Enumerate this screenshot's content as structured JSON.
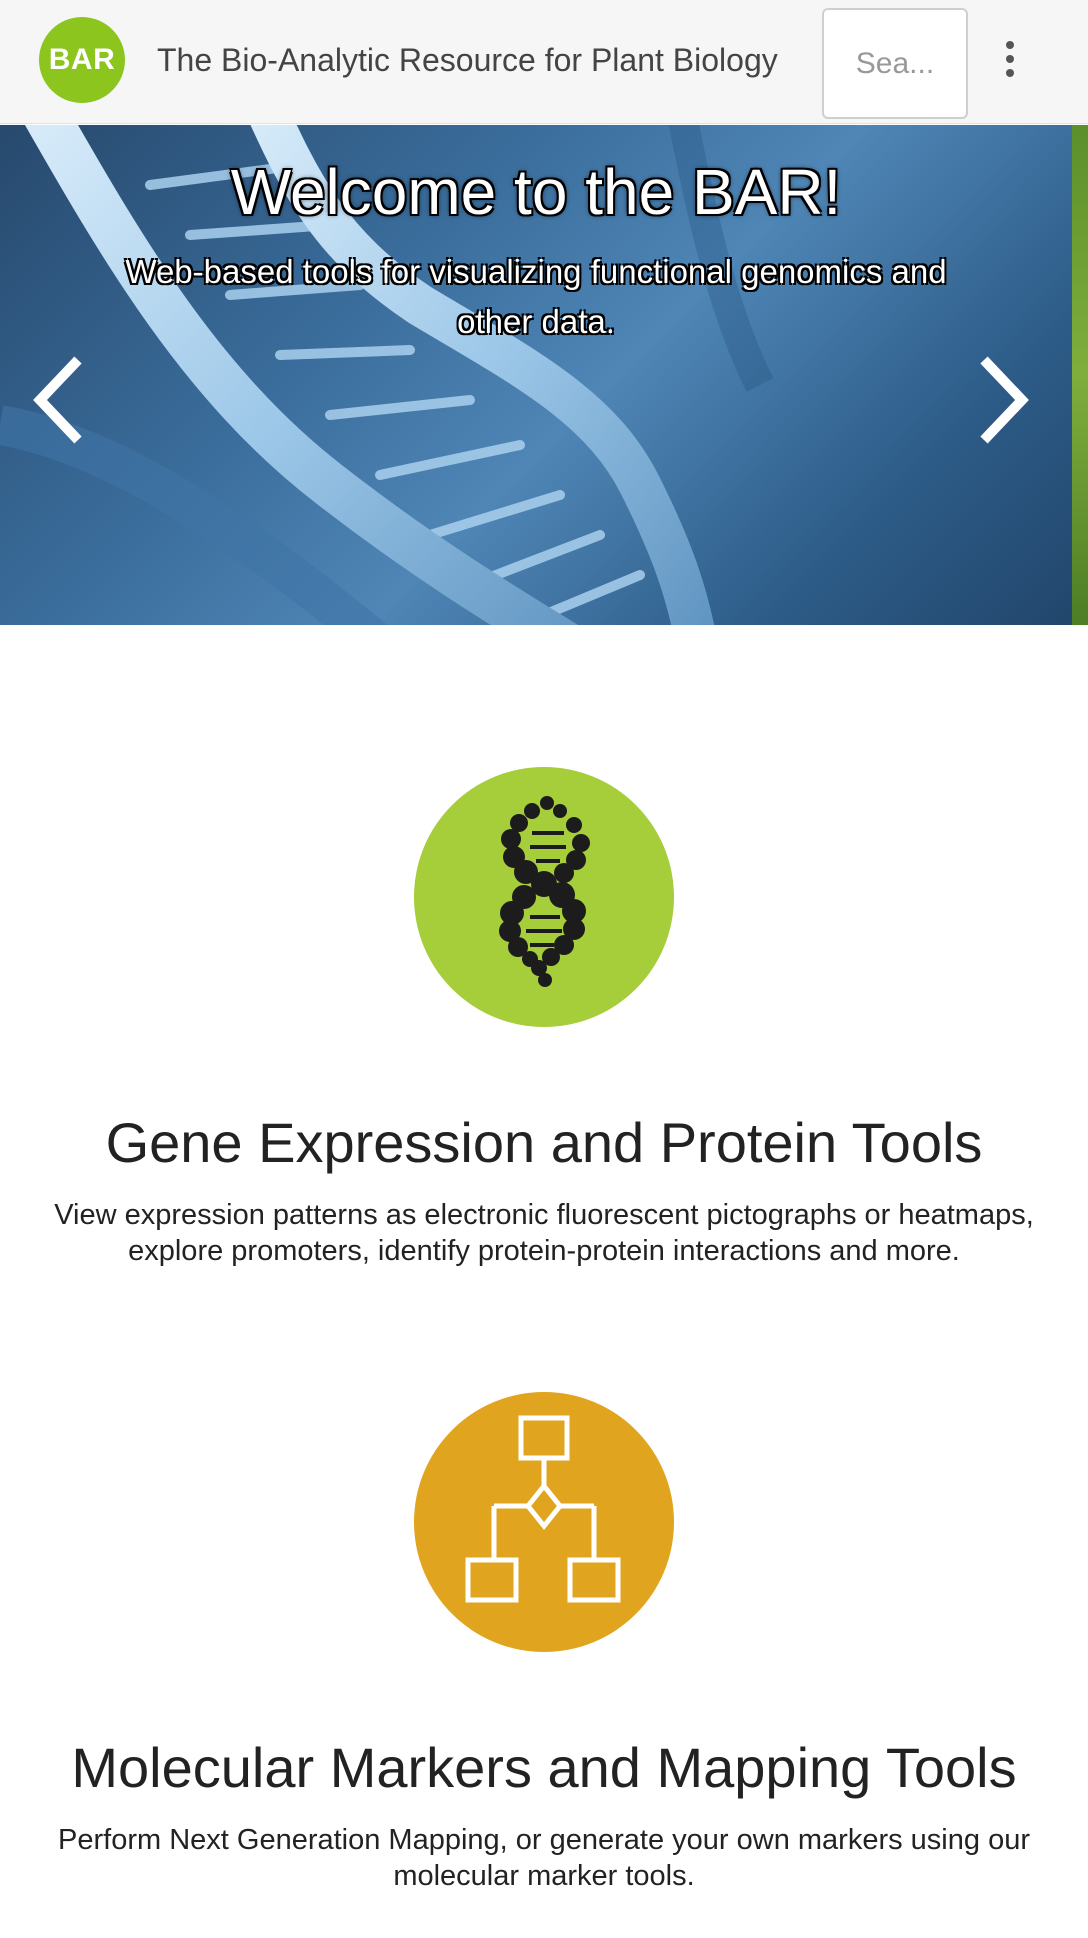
{
  "header": {
    "logo_text": "BAR",
    "title": "The Bio-Analytic Resource for Plant Biology",
    "search_placeholder": "Sea...",
    "menu_icon": "kebab-menu-icon"
  },
  "carousel": {
    "title": "Welcome to the BAR!",
    "subtitle": "Web-based tools for visualizing functional genomics and other data.",
    "prev_icon": "chevron-left-icon",
    "next_icon": "chevron-right-icon"
  },
  "features": [
    {
      "icon": "dna-icon",
      "icon_color": "#a6cd3a",
      "title": "Gene Expression and Protein Tools",
      "description": "View expression patterns as electronic fluorescent pictographs or heatmaps, explore promoters, identify protein-protein interactions and more."
    },
    {
      "icon": "flowchart-icon",
      "icon_color": "#e0a41e",
      "title": "Molecular Markers and Mapping Tools",
      "description": "Perform Next Generation Mapping, or generate your own markers using our molecular marker tools."
    }
  ],
  "colors": {
    "brand_green": "#8cc51e",
    "header_bg": "#f6f6f6"
  }
}
